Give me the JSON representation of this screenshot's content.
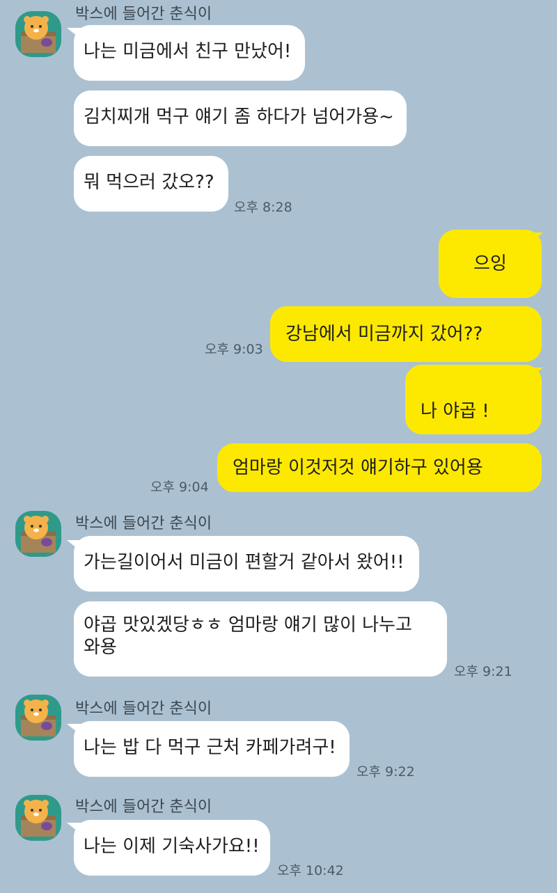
{
  "sender_name": "박스에 들어간 춘식이",
  "groups": [
    {
      "messages": [
        {
          "text": "나는 미금에서 친구 만났어!"
        },
        {
          "text": "김치찌개 먹구 얘기 좀 하다가 넘어가용~"
        },
        {
          "text": "뭐 먹으러 갔오??",
          "time": "오후 8:28"
        }
      ]
    },
    {
      "outgoing": [
        {
          "text": "으잉"
        },
        {
          "text": "강남에서 미금까지 갔어??",
          "time": "오후 9:03"
        },
        {
          "text": "나 야곱 !"
        },
        {
          "text": "엄마랑 이것저것 얘기하구 있어용",
          "time": "오후 9:04"
        }
      ]
    },
    {
      "messages": [
        {
          "text": "가는길이어서 미금이 편할거 같아서 왔어!!"
        },
        {
          "text": "야곱 맛있겠당ㅎㅎ 엄마랑 얘기 많이 나누고와용",
          "time": "오후 9:21"
        }
      ]
    },
    {
      "messages": [
        {
          "text": "나는 밥 다 먹구 근처 카페가려구!",
          "time": "오후 9:22"
        }
      ]
    },
    {
      "messages": [
        {
          "text": "나는 이제 기숙사가요!!",
          "time": "오후 10:42"
        }
      ]
    }
  ],
  "colors": {
    "background": "#abc1d1",
    "incoming_bubble": "#ffffff",
    "outgoing_bubble": "#fde900",
    "avatar_bg": "#2f9a8a"
  },
  "icons": {
    "avatar": "choonsik-in-box-icon"
  }
}
